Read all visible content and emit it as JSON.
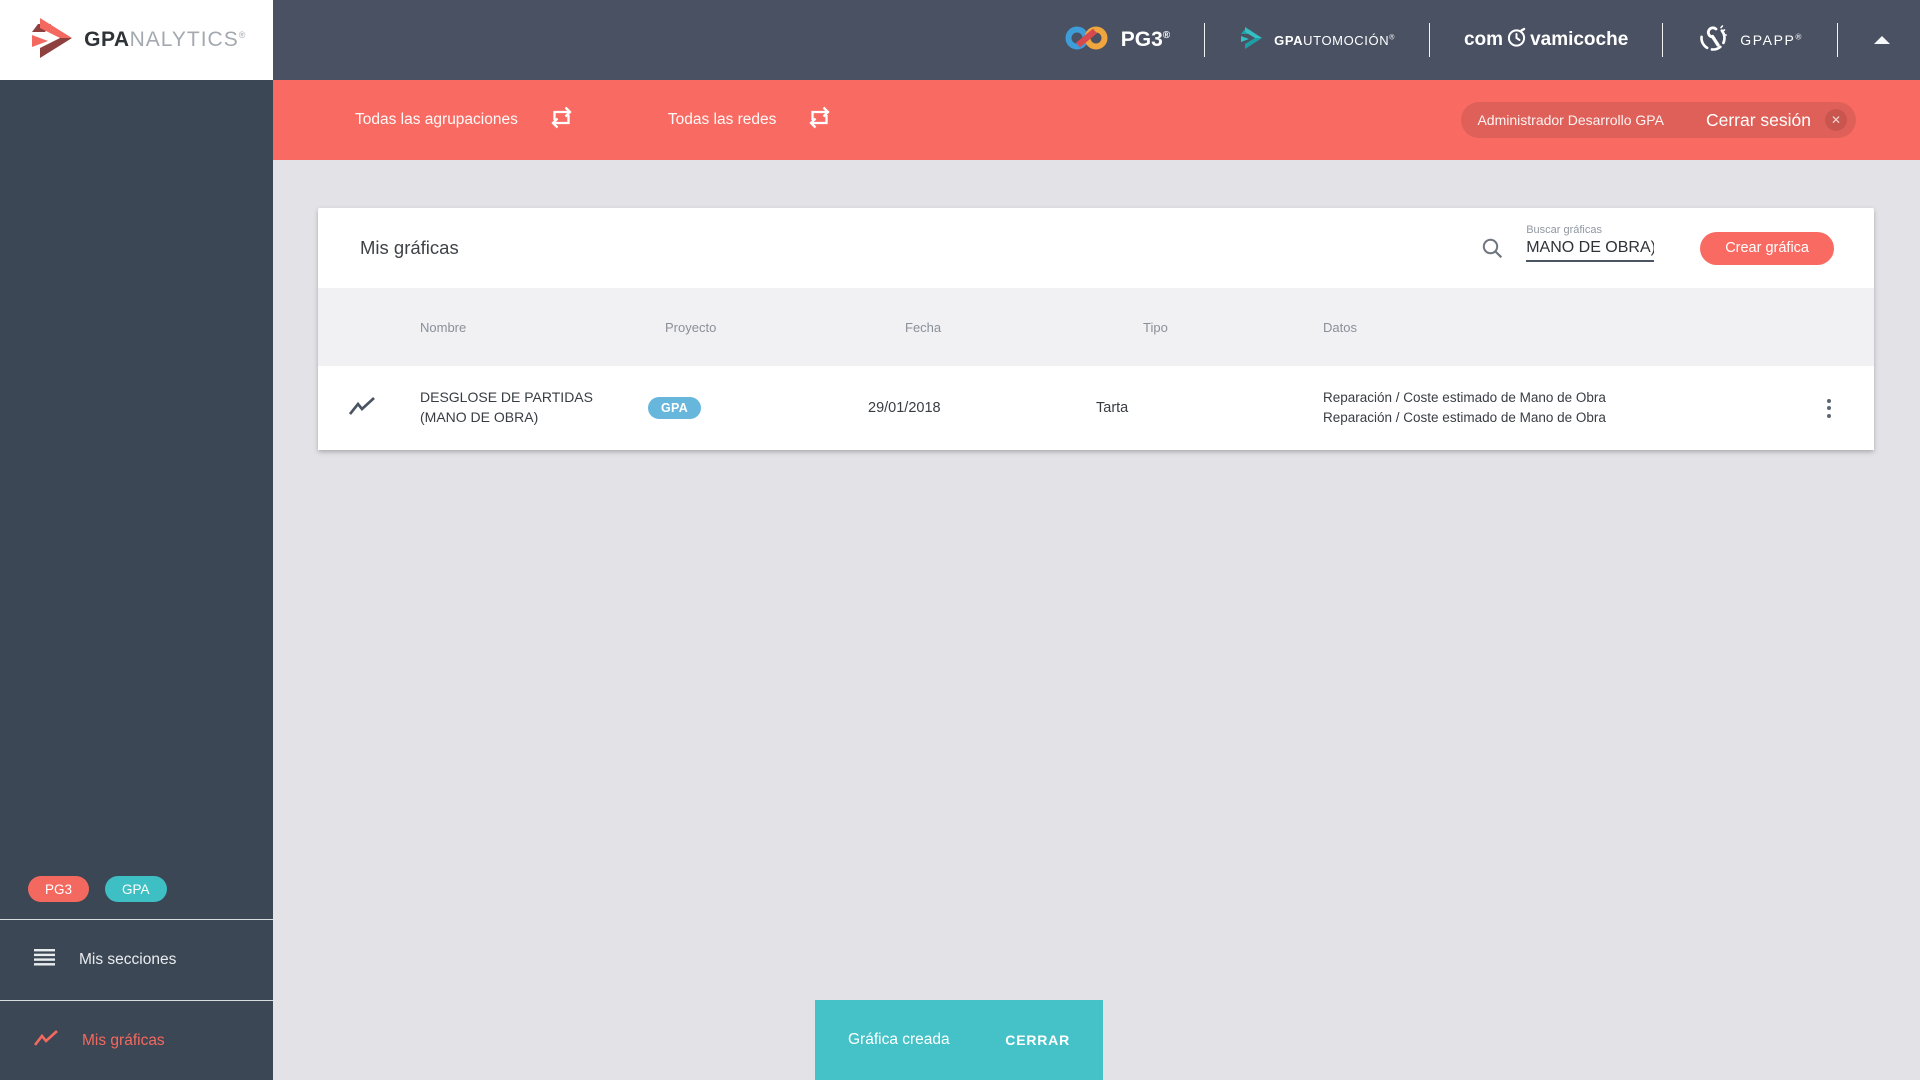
{
  "brand": {
    "name_bold": "GPA",
    "name_light": "NALYTICS",
    "registered": "®"
  },
  "topbar": {
    "pg3": {
      "label": "PG3",
      "registered": "®"
    },
    "gpautomocion": {
      "label_bold": "GPA",
      "label_rest": "UTOMOCIÓN",
      "registered": "®"
    },
    "comprovamicoche": {
      "prefix": "com",
      "suffix": "vamicoche"
    },
    "gpapp": {
      "label": "GPAPP",
      "registered": "®"
    }
  },
  "filterbar": {
    "agrupaciones": "Todas las agrupaciones",
    "redes": "Todas las redes",
    "user": "Administrador Desarrollo GPA",
    "logout": "Cerrar sesión",
    "close_icon": "✕"
  },
  "sidebar": {
    "badges": [
      {
        "label": "PG3"
      },
      {
        "label": "GPA"
      }
    ],
    "items": [
      {
        "label": "Mis secciones"
      },
      {
        "label": "Mis gráficas"
      }
    ]
  },
  "content": {
    "title": "Mis gráficas",
    "search": {
      "label": "Buscar gráficas",
      "value": "MANO DE OBRA)"
    },
    "create_button": "Crear gráfica",
    "table": {
      "columns": [
        "Nombre",
        "Proyecto",
        "Fecha",
        "Tipo",
        "Datos"
      ],
      "rows": [
        {
          "nombre": "DESGLOSE DE PARTIDAS (MANO DE OBRA)",
          "proyecto": "GPA",
          "fecha": "29/01/2018",
          "tipo": "Tarta",
          "datos": [
            "Reparación / Coste estimado de Mano de Obra",
            "Reparación / Coste estimado de Mano de Obra"
          ]
        }
      ]
    }
  },
  "snackbar": {
    "message": "Gráfica creada",
    "action": "CERRAR"
  },
  "colors": {
    "accent": "#F96B62",
    "topbar": "#4A5162",
    "sidebar": "#3B4754",
    "teal_snackbar": "#45C2C8",
    "project_badge_blue": "#67B6DC",
    "sidebar_badge_teal": "#3EBFC4"
  }
}
